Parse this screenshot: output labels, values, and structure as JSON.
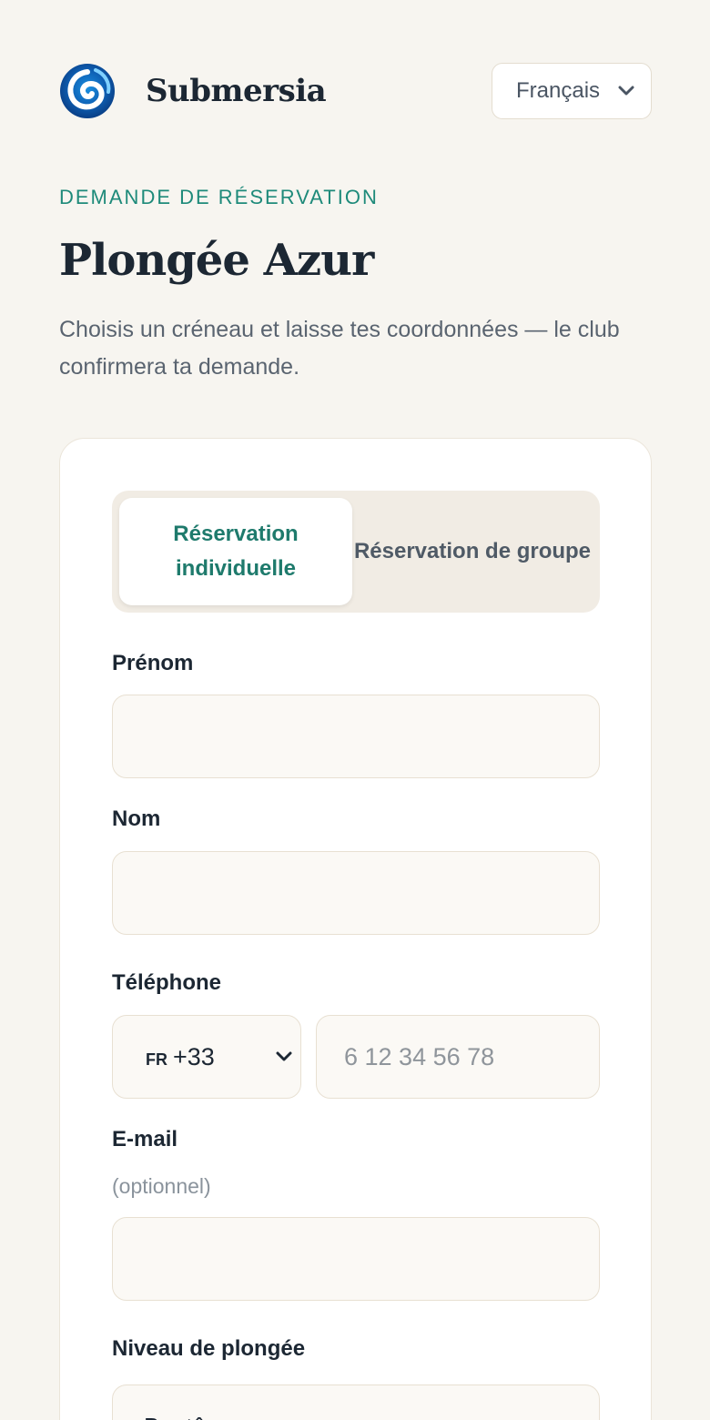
{
  "header": {
    "brand_name": "Submersia",
    "logo_icon": "wave-logo-icon",
    "language": "Français"
  },
  "eyebrow": "DEMANDE DE RÉSERVATION",
  "title": "Plongée Azur",
  "subtitle": "Choisis un créneau et laisse tes coordonnées — le club confirmera ta demande.",
  "tabs": [
    {
      "label": "Réservation individuelle",
      "active": true
    },
    {
      "label": "Réservation de groupe",
      "active": false
    }
  ],
  "form": {
    "first_name_label": "Prénom",
    "first_name_value": "",
    "last_name_label": "Nom",
    "last_name_value": "",
    "phone_label": "Téléphone",
    "phone_country": "FR",
    "phone_dial": "+33",
    "phone_placeholder": "6 12 34 56 78",
    "email_label": "E-mail",
    "email_hint": "(optionnel)",
    "email_value": "",
    "level_label": "Niveau de plongée",
    "level_value": "Baptême"
  },
  "colors": {
    "accent": "#1e8a7a",
    "background": "#f7f5f0",
    "text": "#1c2733"
  }
}
